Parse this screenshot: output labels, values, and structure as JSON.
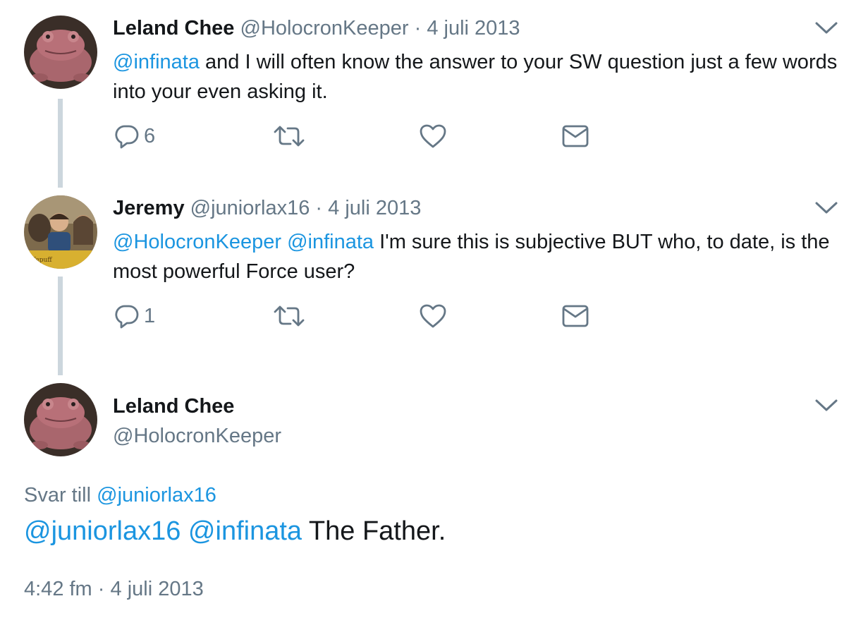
{
  "colors": {
    "link": "#1b95e0",
    "secondary_text": "#657786",
    "primary_text": "#14171a",
    "thread_line": "#ccd6dd"
  },
  "tweets": [
    {
      "author_name": "Leland Chee",
      "handle": "@HolocronKeeper",
      "separator": "·",
      "date": "4 juli 2013",
      "mentions": [
        "@infinata"
      ],
      "text": "and I will often know the answer to your SW question just a few words into your even asking it.",
      "reply_count": "6",
      "avatar_icon": "toad-avatar-icon",
      "icons": [
        "reply-icon",
        "retweet-icon",
        "like-icon",
        "direct-message-icon",
        "chevron-down-icon"
      ]
    },
    {
      "author_name": "Jeremy",
      "handle": "@juniorlax16",
      "separator": "·",
      "date": "4 juli 2013",
      "mentions": [
        "@HolocronKeeper",
        "@infinata"
      ],
      "text": "I'm sure this is subjective BUT who, to date, is the most powerful Force user?",
      "reply_count": "1",
      "avatar_icon": "photo-avatar-icon",
      "avatar_text": "ffepuff",
      "icons": [
        "reply-icon",
        "retweet-icon",
        "like-icon",
        "direct-message-icon",
        "chevron-down-icon"
      ]
    }
  ],
  "main_tweet": {
    "author_name": "Leland Chee",
    "handle": "@HolocronKeeper",
    "reply_prefix": "Svar till",
    "reply_to": "@juniorlax16",
    "mentions": [
      "@juniorlax16",
      "@infinata"
    ],
    "text": "The Father.",
    "time": "4:42 fm",
    "separator": "·",
    "date": "4 juli 2013",
    "avatar_icon": "toad-avatar-icon"
  }
}
